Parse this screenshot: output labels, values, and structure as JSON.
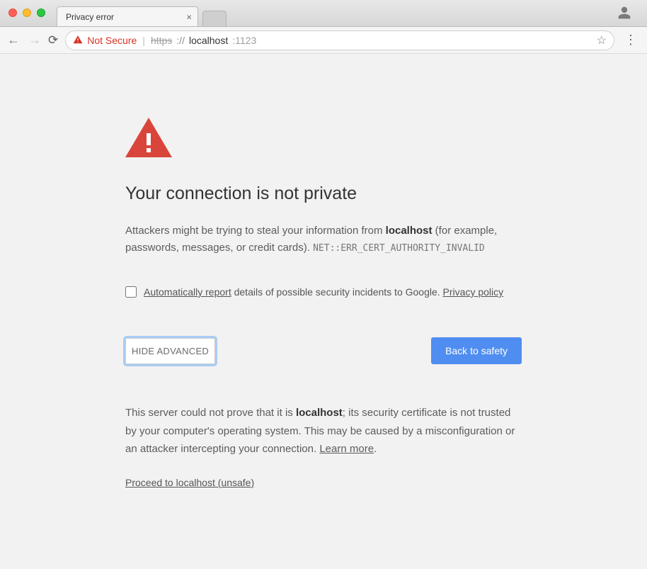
{
  "browser": {
    "tab_title": "Privacy error",
    "not_secure_label": "Not Secure",
    "url_scheme_struck": "https",
    "url_scheme_rest": "://",
    "url_host": "localhost",
    "url_port": ":1123"
  },
  "page": {
    "heading": "Your connection is not private",
    "body_pre": "Attackers might be trying to steal your information from ",
    "body_host": "localhost",
    "body_post": " (for example, passwords, messages, or credit cards). ",
    "error_code": "NET::ERR_CERT_AUTHORITY_INVALID",
    "report_underlined": "Automatically report",
    "report_rest": " details of possible security incidents to Google. ",
    "privacy_policy": "Privacy policy",
    "btn_advanced": "HIDE ADVANCED",
    "btn_safety": "Back to safety",
    "adv_pre": "This server could not prove that it is ",
    "adv_host": "localhost",
    "adv_post1": "; its security certificate is not trusted by your computer's operating system. This may be caused by a misconfiguration or an attacker intercepting your connection. ",
    "learn_more": "Learn more",
    "adv_post2": ".",
    "proceed": "Proceed to localhost (unsafe)"
  }
}
